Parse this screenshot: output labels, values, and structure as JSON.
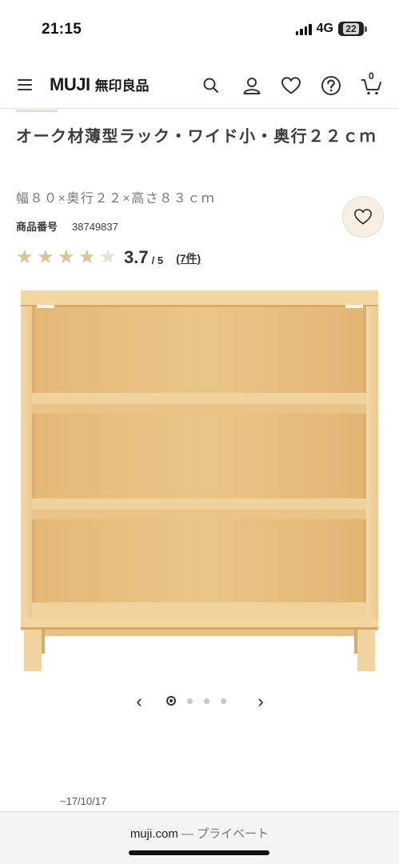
{
  "status_bar": {
    "time": "21:15",
    "network": "4G",
    "battery": "22"
  },
  "header": {
    "logo": "MUJI",
    "logo_jp": "無印良品",
    "cart_count": "0",
    "icons": [
      "menu-icon",
      "search-icon",
      "account-icon",
      "heart-icon",
      "help-icon",
      "cart-icon"
    ]
  },
  "product": {
    "title": "オーク材薄型ラック・ワイド小・奥行２２ｃｍ",
    "size": "幅８０×奥行２２×高さ８３ｃｍ",
    "code_label": "商品番号",
    "code": "38749837",
    "rating": 3.7,
    "rating_value": "3.7",
    "rating_max": "/ 5",
    "review_count": "(7件)"
  },
  "carousel": {
    "total": 4,
    "active": 1,
    "prev": "‹",
    "next": "›"
  },
  "date_note": "~17/10/17",
  "browser": {
    "domain": "muji.com",
    "subtitle": " — プライベート"
  },
  "colors": {
    "star": "#d8c495",
    "favorite_bg": "#f7efe4",
    "wood": "#ecc98f"
  }
}
